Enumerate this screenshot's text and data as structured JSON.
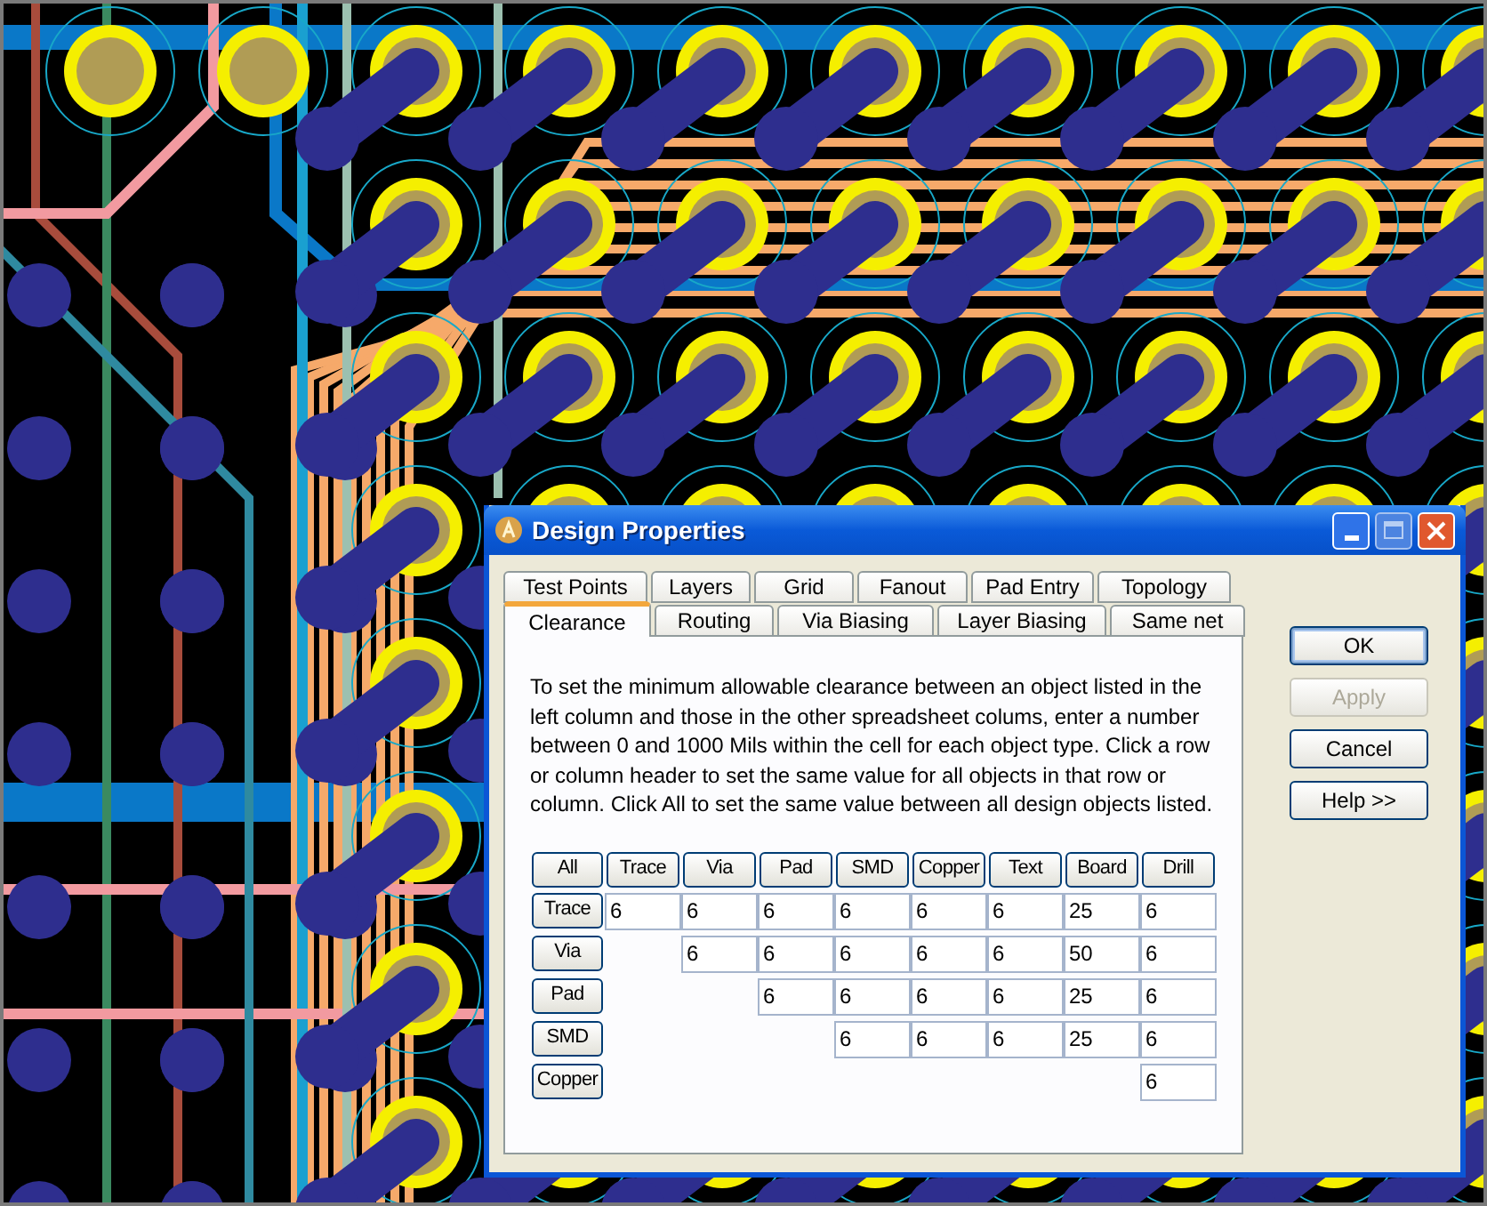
{
  "window": {
    "title": "Design Properties"
  },
  "tabs": [
    [
      {
        "label": "Test Points",
        "selected": false
      },
      {
        "label": "Layers",
        "selected": false
      },
      {
        "label": "Grid",
        "selected": false
      },
      {
        "label": "Fanout",
        "selected": false
      },
      {
        "label": "Pad Entry",
        "selected": false
      },
      {
        "label": "Topology",
        "selected": false
      }
    ],
    [
      {
        "label": "Clearance",
        "selected": true
      },
      {
        "label": "Routing",
        "selected": false
      },
      {
        "label": "Via Biasing",
        "selected": false
      },
      {
        "label": "Layer Biasing",
        "selected": false
      },
      {
        "label": "Same net",
        "selected": false
      }
    ]
  ],
  "buttons": [
    {
      "label": "OK",
      "disabled": false,
      "default": true
    },
    {
      "label": "Apply",
      "disabled": true,
      "default": false
    },
    {
      "label": "Cancel",
      "disabled": false,
      "default": false
    },
    {
      "label": "Help >>",
      "disabled": false,
      "default": false
    }
  ],
  "description": "To set the minimum allowable clearance between an object listed in the left column and those in the other spreadsheet colums, enter a number between 0 and 1000 Mils within the cell for each object type. Click a row or column header to set the same value for all objects in that row or column. Click All to set the same value between all design objects listed.",
  "grid": {
    "corner": "All",
    "columns": [
      "Trace",
      "Via",
      "Pad",
      "SMD",
      "Copper",
      "Text",
      "Board",
      "Drill"
    ],
    "rows": [
      {
        "header": "Trace",
        "values": [
          "6",
          "6",
          "6",
          "6",
          "6",
          "6",
          "25",
          "6"
        ]
      },
      {
        "header": "Via",
        "values": [
          "6",
          "6",
          "6",
          "6",
          "6",
          "50",
          "6"
        ]
      },
      {
        "header": "Pad",
        "values": [
          "6",
          "6",
          "6",
          "6",
          "25",
          "6"
        ]
      },
      {
        "header": "SMD",
        "values": [
          "6",
          "6",
          "6",
          "25",
          "6"
        ]
      },
      {
        "header": "Copper",
        "values": [
          "6"
        ]
      }
    ]
  }
}
